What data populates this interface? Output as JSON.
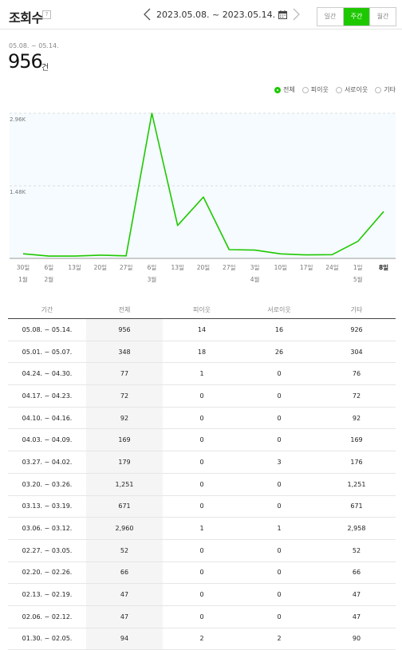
{
  "header": {
    "title": "조회수",
    "help": "?",
    "date_range": "2023.05.08. ~ 2023.05.14.",
    "period_tabs": [
      {
        "label": "일간",
        "active": false
      },
      {
        "label": "주간",
        "active": true
      },
      {
        "label": "월간",
        "active": false
      }
    ]
  },
  "summary": {
    "range": "05.08. ~ 05.14.",
    "total": "956",
    "unit": "건"
  },
  "legend": [
    {
      "label": "전체",
      "selected": true
    },
    {
      "label": "피이웃",
      "selected": false
    },
    {
      "label": "서로이웃",
      "selected": false
    },
    {
      "label": "기타",
      "selected": false
    }
  ],
  "colors": {
    "accent": "#1ec800",
    "chart_bg": "#f5fbfe"
  },
  "icons": [
    "chevron-left-icon",
    "calendar-icon",
    "chevron-right-icon",
    "help-icon",
    "radio-icon"
  ],
  "chart_data": {
    "type": "line",
    "x_ticks": [
      {
        "day": "30일",
        "month": "1월"
      },
      {
        "day": "6일",
        "month": "2월"
      },
      {
        "day": "13일",
        "month": ""
      },
      {
        "day": "20일",
        "month": ""
      },
      {
        "day": "27일",
        "month": ""
      },
      {
        "day": "6일",
        "month": "3월"
      },
      {
        "day": "13일",
        "month": ""
      },
      {
        "day": "20일",
        "month": ""
      },
      {
        "day": "27일",
        "month": ""
      },
      {
        "day": "3일",
        "month": "4월"
      },
      {
        "day": "10일",
        "month": ""
      },
      {
        "day": "17일",
        "month": ""
      },
      {
        "day": "24일",
        "month": ""
      },
      {
        "day": "1일",
        "month": "5월"
      },
      {
        "day": "8일",
        "month": ""
      }
    ],
    "y_ticks": [
      "2.96K",
      "1.48K"
    ],
    "ylim": [
      0,
      2960
    ],
    "grid": "horizontal dashed",
    "series": [
      {
        "values": [
          94,
          47,
          47,
          66,
          52,
          2960,
          671,
          1251,
          179,
          169,
          92,
          72,
          77,
          348,
          956
        ]
      }
    ]
  },
  "table": {
    "headers": [
      "기간",
      "전체",
      "피이웃",
      "서로이웃",
      "기타"
    ],
    "rows": [
      [
        "05.08. ~ 05.14.",
        "956",
        "14",
        "16",
        "926"
      ],
      [
        "05.01. ~ 05.07.",
        "348",
        "18",
        "26",
        "304"
      ],
      [
        "04.24. ~ 04.30.",
        "77",
        "1",
        "0",
        "76"
      ],
      [
        "04.17. ~ 04.23.",
        "72",
        "0",
        "0",
        "72"
      ],
      [
        "04.10. ~ 04.16.",
        "92",
        "0",
        "0",
        "92"
      ],
      [
        "04.03. ~ 04.09.",
        "169",
        "0",
        "0",
        "169"
      ],
      [
        "03.27. ~ 04.02.",
        "179",
        "0",
        "3",
        "176"
      ],
      [
        "03.20. ~ 03.26.",
        "1,251",
        "0",
        "0",
        "1,251"
      ],
      [
        "03.13. ~ 03.19.",
        "671",
        "0",
        "0",
        "671"
      ],
      [
        "03.06. ~ 03.12.",
        "2,960",
        "1",
        "1",
        "2,958"
      ],
      [
        "02.27. ~ 03.05.",
        "52",
        "0",
        "0",
        "52"
      ],
      [
        "02.20. ~ 02.26.",
        "66",
        "0",
        "0",
        "66"
      ],
      [
        "02.13. ~ 02.19.",
        "47",
        "0",
        "0",
        "47"
      ],
      [
        "02.06. ~ 02.12.",
        "47",
        "0",
        "0",
        "47"
      ],
      [
        "01.30. ~ 02.05.",
        "94",
        "2",
        "2",
        "90"
      ]
    ]
  }
}
